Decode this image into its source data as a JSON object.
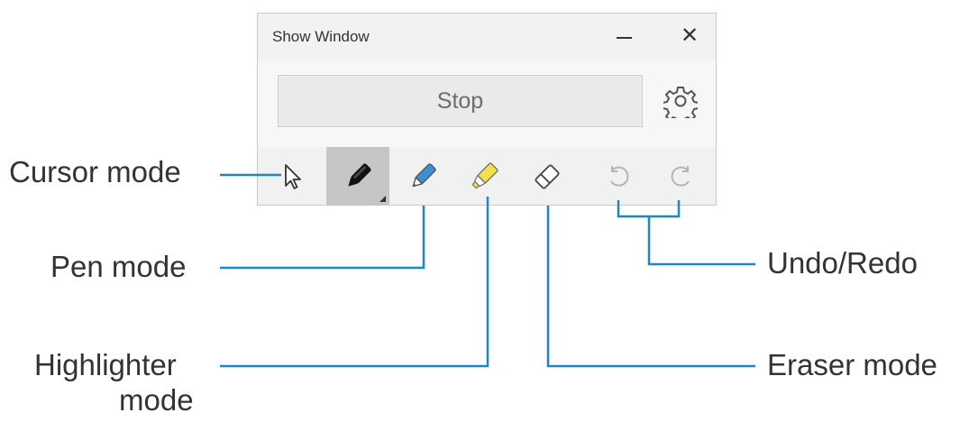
{
  "window": {
    "title": "Show Window",
    "minimize_icon": "minimize-icon",
    "close_glyph": "✕",
    "stop_label": "Stop",
    "settings_icon": "gear-icon"
  },
  "toolbar": {
    "tools": [
      {
        "name": "cursor",
        "icon": "cursor-arrow-icon",
        "active": false
      },
      {
        "name": "pen-dark",
        "icon": "black-pen-icon",
        "active": true
      },
      {
        "name": "pen",
        "icon": "blue-pen-icon",
        "active": false
      },
      {
        "name": "highlighter",
        "icon": "yellow-highlighter-icon",
        "active": false
      },
      {
        "name": "eraser",
        "icon": "eraser-icon",
        "active": false
      },
      {
        "name": "undo",
        "icon": "undo-icon",
        "active": false
      },
      {
        "name": "redo",
        "icon": "redo-icon",
        "active": false
      }
    ]
  },
  "callouts": {
    "cursor_mode": "Cursor mode",
    "pen_mode": "Pen mode",
    "highlighter_line1": "Highlighter",
    "highlighter_line2": "mode",
    "undo_redo": "Undo/Redo",
    "eraser_mode": "Eraser mode"
  },
  "colors": {
    "callout_line": "#1f86c6",
    "pen_blue": "#3a8fd8",
    "highlighter_yellow": "#f2e04a",
    "text": "#333333"
  }
}
